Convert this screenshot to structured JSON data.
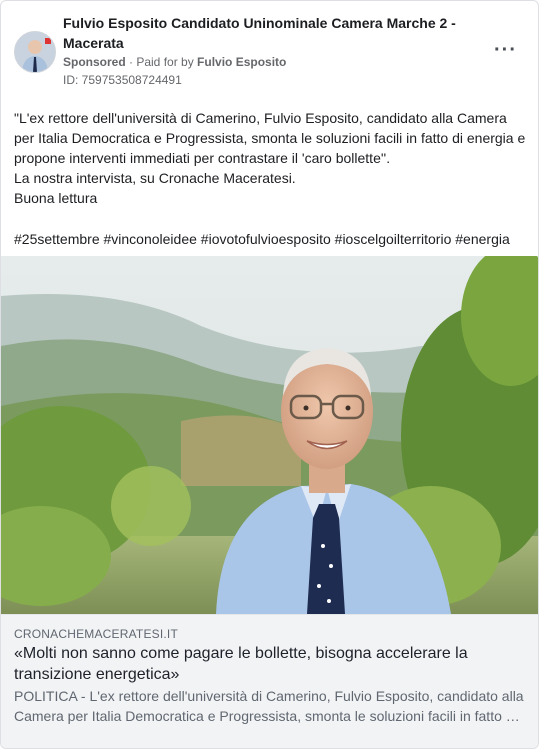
{
  "header": {
    "page_name": "Fulvio Esposito Candidato Uninominale Camera Marche 2 - Macerata",
    "sponsored": "Sponsored",
    "paid_for_prefix": " · Paid for by ",
    "paid_for_name": "Fulvio Esposito",
    "ad_id": "ID: 759753508724491",
    "more_icon": "more-horizontal-icon"
  },
  "post": {
    "line1": "\"L'ex rettore dell'università di Camerino, Fulvio Esposito, candidato alla Camera per Italia Democratica e Progressista, smonta le soluzioni facili in fatto di energia e propone interventi immediati per contrastare il 'caro bollette''.",
    "line2": "La nostra intervista, su Cronache Maceratesi.",
    "line3": "Buona lettura",
    "hashtags": "#25settembre #vinconoleidee #iovotofulvioesposito #ioscelgoilterritorio #energia"
  },
  "link": {
    "domain": "CRONACHEMACERATESI.IT",
    "title": "«Molti non sanno come pagare le bollette, bisogna accelerare la transizione energetica»",
    "description": "POLITICA - L'ex rettore dell'università di Camerino, Fulvio Esposito, candidato alla Camera per Italia Democratica e Progressista, smonta le soluzioni facili in fatto …"
  },
  "colors": {
    "text": "#1c1e21",
    "muted": "#65676b",
    "link_bg": "#f2f3f5"
  }
}
